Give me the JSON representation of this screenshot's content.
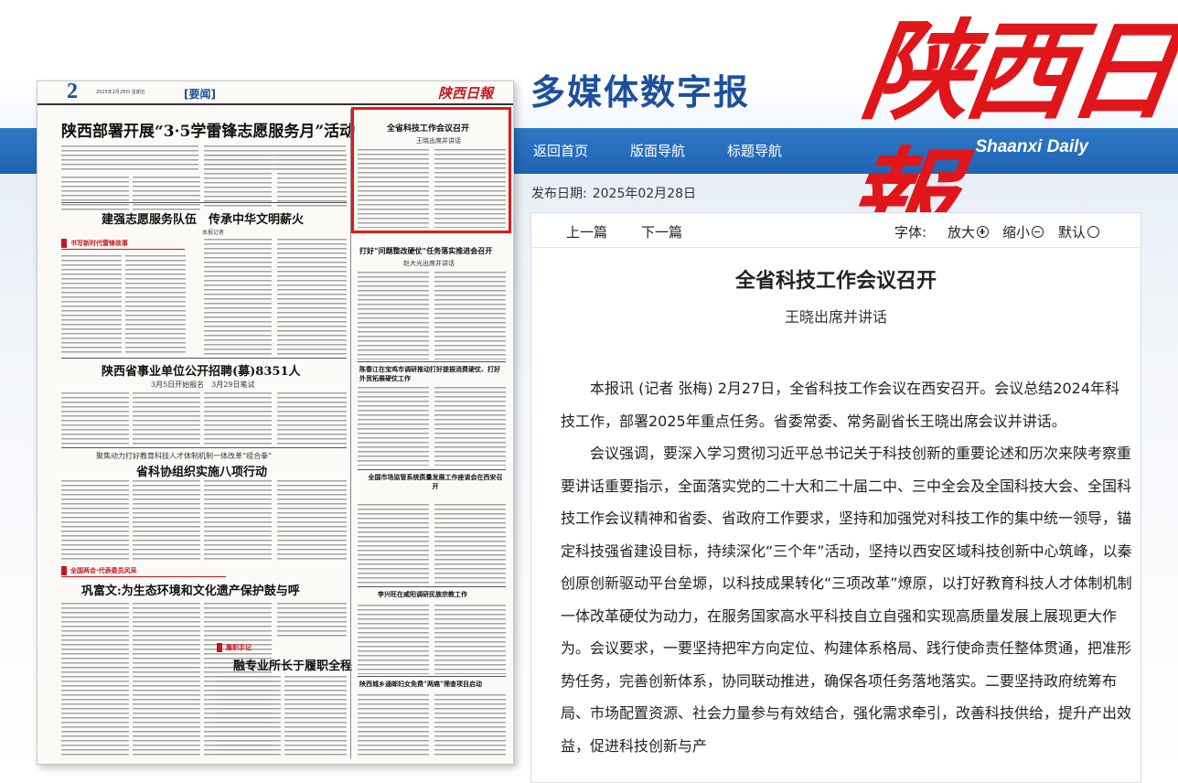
{
  "header": {
    "subtitle": "多媒体数字报",
    "logo_cn": "陕西日報",
    "logo_en": "Shaanxi Daily",
    "nav": [
      {
        "label": "返回首页"
      },
      {
        "label": "版面导航"
      },
      {
        "label": "标题导航"
      }
    ]
  },
  "publish": {
    "label": "发布日期:",
    "date": "2025年02月28日"
  },
  "page_thumb": {
    "page_number": "2",
    "meta": "2025年2月28日 星期五",
    "section": "[要闻]",
    "logo": "陕西日報",
    "headlines": [
      "陕西部署开展“3·5学雷锋志愿服务月”活动",
      "建强志愿服务队伍　传承中华文明薪火",
      "陕西省事业单位公开招聘(募)8351人",
      "3月5日开始报名　3月29日笔试",
      "聚焦动力打好教育科技人才体制机制一体改革“组合拳”",
      "省科协组织实施八项行动",
      "巩富文:为生态环境和文化遗产保护鼓与呼",
      "融专业所长于履职全程",
      "全省科技工作会议召开",
      "王晓出席并讲话",
      "打好“问题整改硬仗”任务落实推进会召开",
      "赵大光出席并讲话",
      "陈春江在宝鸡市调研推动打好提振消费硬仗、打好外贸拓展硬仗工作",
      "全国市场监管系统质量发展工作座谈会在西安召开",
      "李兴旺在咸阳调研民族宗教工作",
      "陕西城乡通邮妇女免费“两癌”筛查项目启动"
    ],
    "bars": [
      "书写新时代雷锋故事",
      "全国两会·代表委员风采",
      "履职手记"
    ]
  },
  "article": {
    "toolbar": {
      "prev": "上一篇",
      "next": "下一篇",
      "font_label": "字体:",
      "zoom_in": "放大",
      "zoom_out": "缩小",
      "default": "默认"
    },
    "title": "全省科技工作会议召开",
    "subtitle": "王晓出席并讲话",
    "paragraphs": [
      "本报讯 (记者 张梅) 2月27日，全省科技工作会议在西安召开。会议总结2024年科技工作，部署2025年重点任务。省委常委、常务副省长王晓出席会议并讲话。",
      "会议强调，要深入学习贯彻习近平总书记关于科技创新的重要论述和历次来陕考察重要讲话重要指示，全面落实党的二十大和二十届二中、三中全会及全国科技大会、全国科技工作会议精神和省委、省政府工作要求，坚持和加强党对科技工作的集中统一领导，锚定科技强省建设目标，持续深化“三个年”活动，坚持以西安区域科技创新中心筑峰，以秦创原创新驱动平台垒塬，以科技成果转化“三项改革”燎原，以打好教育科技人才体制机制一体改革硬仗为动力，在服务国家高水平科技自立自强和实现高质量发展上展现更大作为。会议要求，一要坚持把牢方向定位、构建体系格局、践行使命责任整体贯通，把准形势任务，完善创新体系，协同联动推进，确保各项任务落地落实。二要坚持政府统筹布局、市场配置资源、社会力量参与有效结合，强化需求牵引，改善科技供给，提升产出效益，促进科技创新与产"
    ]
  }
}
